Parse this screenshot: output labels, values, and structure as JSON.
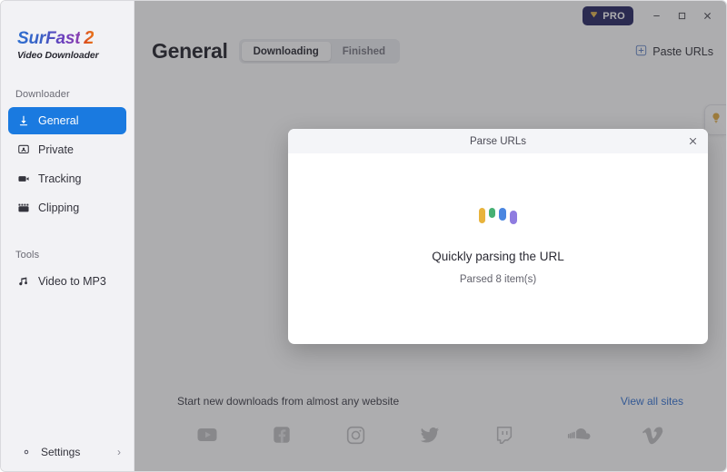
{
  "window": {
    "pro_badge": {
      "label": "PRO",
      "icon": "gem-icon",
      "bg": "#20205e",
      "fg": "#e9b949"
    },
    "controls": {
      "minimize": "–",
      "maximize": "□",
      "close": "✕"
    }
  },
  "sidebar": {
    "logo": {
      "name": "SurFast",
      "version": "2",
      "subtitle": "Video Downloader"
    },
    "sections": [
      {
        "label": "Downloader",
        "items": [
          {
            "label": "General",
            "icon": "download-arrow-icon",
            "active": true
          },
          {
            "label": "Private",
            "icon": "private-screen-icon",
            "active": false
          },
          {
            "label": "Tracking",
            "icon": "camera-icon",
            "active": false
          },
          {
            "label": "Clipping",
            "icon": "clapperboard-icon",
            "active": false
          }
        ]
      },
      {
        "label": "Tools",
        "items": [
          {
            "label": "Video to MP3",
            "icon": "music-note-icon",
            "active": false
          }
        ]
      }
    ],
    "settings": {
      "label": "Settings",
      "icon": "gear-icon",
      "chevron": "›"
    }
  },
  "header": {
    "title": "General",
    "tabs": [
      {
        "label": "Downloading",
        "active": true
      },
      {
        "label": "Finished",
        "active": false
      }
    ],
    "paste_button": {
      "label": "Paste URLs",
      "icon": "plus-square-icon"
    },
    "tip_tab": {
      "icon": "lightbulb-icon"
    }
  },
  "promo": {
    "text": "Start new downloads from almost any website",
    "link": "View all sites",
    "link_color": "#2f6fd0",
    "sites": [
      {
        "name": "youtube-icon"
      },
      {
        "name": "facebook-icon"
      },
      {
        "name": "instagram-icon"
      },
      {
        "name": "twitter-icon"
      },
      {
        "name": "twitch-icon"
      },
      {
        "name": "soundcloud-icon"
      },
      {
        "name": "vimeo-icon"
      }
    ]
  },
  "modal": {
    "title": "Parse URLs",
    "close_glyph": "✕",
    "loading_text": "Quickly parsing the URL",
    "parsed_text": "Parsed 8 item(s)",
    "parsed_count": 8,
    "dots": [
      {
        "color": "#e8b33c",
        "w": 7,
        "h": 17
      },
      {
        "color": "#46b073",
        "w": 7,
        "h": 11
      },
      {
        "color": "#4a86e0",
        "w": 8,
        "h": 14
      },
      {
        "color": "#8f7ce0",
        "w": 8,
        "h": 15
      }
    ]
  }
}
